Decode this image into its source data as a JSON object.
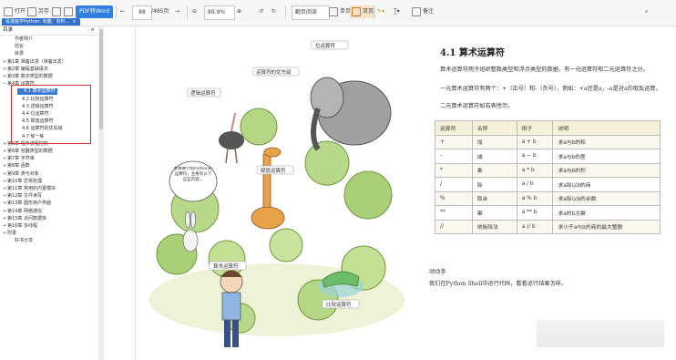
{
  "toolbar": {
    "open": "打开",
    "save": "另存",
    "pdf_label": "PDF转Word",
    "page_current": "88",
    "page_total": "/485页",
    "zoom": "89.9%",
    "view_mode": "翻页阅读",
    "single": "单页",
    "double": "双页",
    "note": "备注"
  },
  "tab": {
    "title": "看漫画学Python: 有趣、有料..."
  },
  "sidebar": {
    "header": "目录",
    "items": [
      {
        "label": "作者简介",
        "indent": 1,
        "expand": ""
      },
      {
        "label": "前言",
        "indent": 1,
        "expand": ""
      },
      {
        "label": "目录",
        "indent": 1,
        "expand": ""
      },
      {
        "label": "第1章 准备出发（准备出发）",
        "indent": 0,
        "expand": "+"
      },
      {
        "label": "第2章 编程基础语法",
        "indent": 0,
        "expand": "+"
      },
      {
        "label": "第3章 数字类型的数据",
        "indent": 0,
        "expand": "+"
      },
      {
        "label": "第4章 运算符",
        "indent": 0,
        "expand": "−"
      },
      {
        "label": "4.1 算术运算符",
        "indent": 2,
        "expand": "",
        "selected": true
      },
      {
        "label": "4.2 比较运算符",
        "indent": 2,
        "expand": ""
      },
      {
        "label": "4.3 逻辑运算符",
        "indent": 2,
        "expand": ""
      },
      {
        "label": "4.4 位运算符",
        "indent": 2,
        "expand": ""
      },
      {
        "label": "4.5 赋值运算符",
        "indent": 2,
        "expand": ""
      },
      {
        "label": "4.6 运算符的优先级",
        "indent": 2,
        "expand": ""
      },
      {
        "label": "4.7 练一练",
        "indent": 2,
        "expand": ""
      },
      {
        "label": "第5章 程序流程控制",
        "indent": 0,
        "expand": "+"
      },
      {
        "label": "第6章 容器类型的数据",
        "indent": 0,
        "expand": "+"
      },
      {
        "label": "第7章 字符串",
        "indent": 0,
        "expand": "+"
      },
      {
        "label": "第8章 函数",
        "indent": 0,
        "expand": "+"
      },
      {
        "label": "第9章 类与对象",
        "indent": 0,
        "expand": "+"
      },
      {
        "label": "第10章 异常处理",
        "indent": 0,
        "expand": "+"
      },
      {
        "label": "第11章 常用的内置模块",
        "indent": 0,
        "expand": "+"
      },
      {
        "label": "第12章 文件读写",
        "indent": 0,
        "expand": "+"
      },
      {
        "label": "第13章 图形用户界面",
        "indent": 0,
        "expand": "+"
      },
      {
        "label": "第14章 网络通信",
        "indent": 0,
        "expand": "+"
      },
      {
        "label": "第15章 访问数据库",
        "indent": 0,
        "expand": "+"
      },
      {
        "label": "第16章 多线程",
        "indent": 0,
        "expand": "+"
      },
      {
        "label": "附录",
        "indent": 0,
        "expand": "+"
      },
      {
        "label": "好书分享",
        "indent": 1,
        "expand": ""
      }
    ]
  },
  "illustration": {
    "labels": {
      "bitwise": "位运算符",
      "comparison": "比较运算符",
      "logic": "逻辑运算符",
      "priority": "运算符的优先级",
      "assign": "赋值运算符",
      "arith": "算术运算符"
    },
    "bubble": "本章要介绍Python的运算符，主要有以下这些内容。"
  },
  "page": {
    "heading": "4.1 算术运算符",
    "p1": "算术运算符用于组织整数类型和浮点类型的数据，有一元运算符和二元运算符之分。",
    "p2": "一元算术运算符有两个：+（正号）和-（负号），例如：+a还是a，-a是对a的取反运算。",
    "p3": "二元算术运算符如右表所示。",
    "table": {
      "headers": [
        "运算符",
        "名称",
        "例子",
        "说明"
      ],
      "rows": [
        [
          "+",
          "加",
          "a + b",
          "求a与b的和"
        ],
        [
          "-",
          "减",
          "a − b",
          "求a与b的差"
        ],
        [
          "*",
          "乘",
          "a * b",
          "求a与b的积"
        ],
        [
          "/",
          "除",
          "a / b",
          "求a除以b的商"
        ],
        [
          "%",
          "取余",
          "a % b",
          "求a除以b的余数"
        ],
        [
          "**",
          "幂",
          "a ** b",
          "求a的b次幂"
        ],
        [
          "//",
          "地板除法",
          "a // b",
          "求小于a与b的商的最大整数"
        ]
      ]
    },
    "p4": "动动手",
    "p5": "我们在Python Shell中运行代码，看看运行结果怎样。"
  }
}
